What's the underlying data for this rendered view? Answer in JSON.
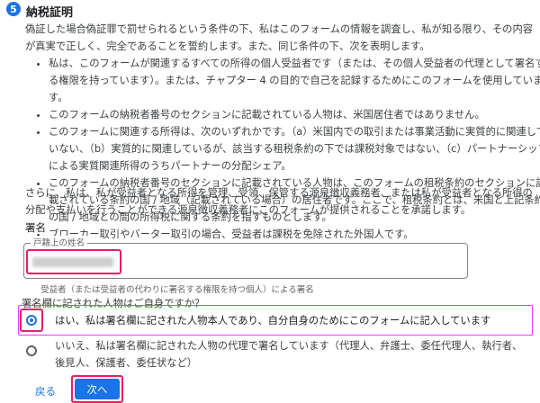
{
  "section": {
    "step_number": "5",
    "title": "納税証明"
  },
  "intro": "偽証した場合偽証罪で罰せられるという条件の下、私はこのフォームの情報を調査し、私が知る限り、その内容が真実で正しく、完全であることを誓約します。また、同じ条件の下、次を表明します。",
  "bullets": [
    "私は、このフォームが関連するすべての所得の個人受益者です（または、その個人受益者の代理として署名する権限を持っています）。または、チャプター 4 の目的で自己を記録するためにこのフォームを使用しています。",
    "このフォームの納税者番号のセクションに記載されている人物は、米国居住者ではありません。",
    "このフォームに関連する所得は、次のいずれかです。（a）米国内での取引または事業活動に実質的に関連していない、（b）実質的に関連しているが、該当する租税条約の下では課税対象ではない、（c）パートナーシップによる実質関連所得のうちパートナーの分配シェア。",
    "このフォームの納税者番号のセクションに記載されている人物は、このフォームの租税条約のセクションに記載されている条約の国 / 地域（記載されている場合）の居住者です。ここで、租税条約とは、米国と上記条約の国 / 地域との間の所得税に関する条約を指すものとします。",
    "ブローカー取引やバーター取引の場合、受益者は課税を免除された外国人です。"
  ],
  "closing": "さらに、私は、私が受益者となる所得を管理、受領、保管する源泉徴収義務者、または私が受益者となる所得の分配や支払いを行うことができる源泉徴収義務者にこのフォームが提供されることを承諾します。",
  "signature": {
    "heading": "署名",
    "field_label": "戸籍上の姓名",
    "helper": "受益者（または受益者の代わりに署名する権限を持つ個人）による署名"
  },
  "question": "署名欄に記された人物はご自身ですか？",
  "options": [
    {
      "label": "はい、私は署名欄に記された人物本人であり、自分自身のためにこのフォームに記入しています",
      "selected": true
    },
    {
      "label": "いいえ、私は署名欄に記された人物の代理で署名しています（代理人、弁護士、委任代理人、執行者、後見人、保護者、委任状など）",
      "selected": false
    }
  ],
  "buttons": {
    "back": "戻る",
    "next": "次へ"
  },
  "colors": {
    "accent": "#1a73e8",
    "highlight": "#e91e63"
  }
}
